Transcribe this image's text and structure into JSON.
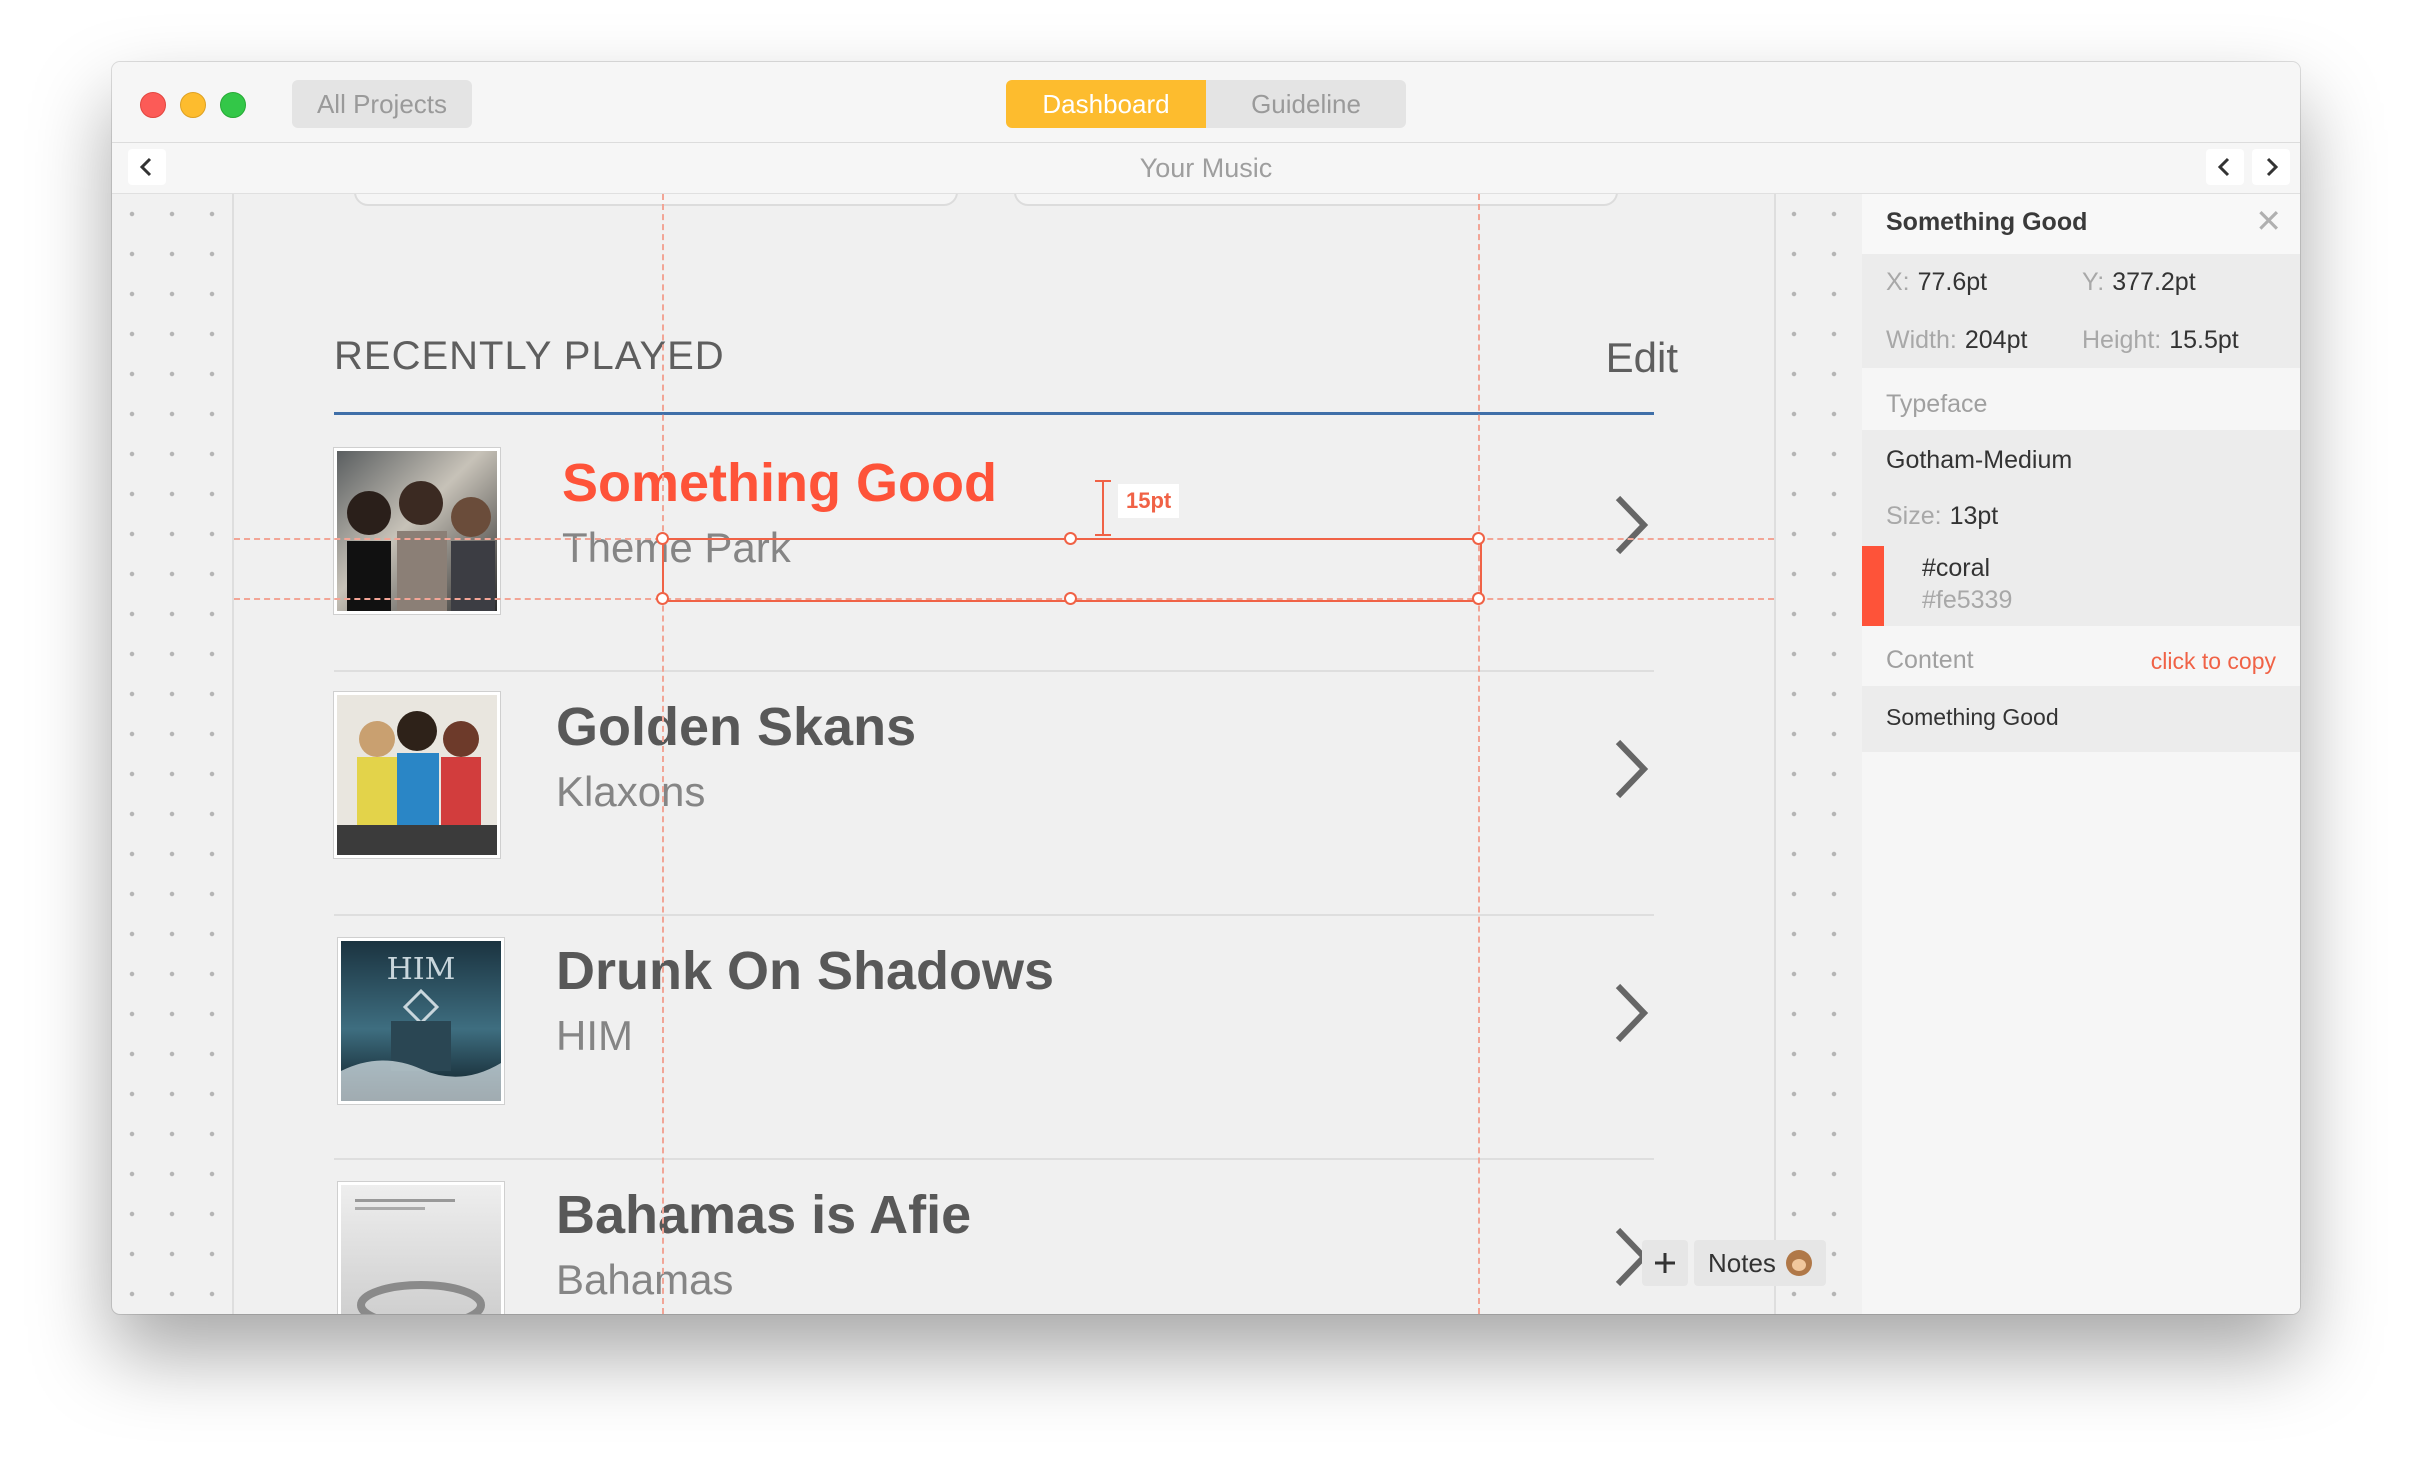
{
  "titlebar": {
    "all_projects": "All Projects",
    "tabs": [
      {
        "label": "Dashboard",
        "active": true
      },
      {
        "label": "Guideline",
        "active": false
      }
    ]
  },
  "navbar": {
    "back_icon": "chevron-left-icon",
    "title": "Your Music",
    "prev_icon": "chevron-left-icon",
    "next_icon": "chevron-right-icon"
  },
  "canvas": {
    "section_title": "RECENTLY PLAYED",
    "edit_label": "Edit",
    "measure_label": "15pt",
    "rows": [
      {
        "title": "Something Good",
        "artist": "Theme Park",
        "selected": true
      },
      {
        "title": "Golden Skans",
        "artist": "Klaxons",
        "selected": false
      },
      {
        "title": "Drunk On Shadows",
        "artist": "HIM",
        "selected": false
      },
      {
        "title": "Bahamas is Afie",
        "artist": "Bahamas",
        "selected": false
      }
    ],
    "cover_text": "HIM",
    "notes": {
      "add_icon": "plus-icon",
      "label": "Notes",
      "emoji_icon": "monkey-icon"
    }
  },
  "inspector": {
    "title": "Something Good",
    "close_icon": "close-icon",
    "x_label": "X:",
    "x_value": "77.6pt",
    "y_label": "Y:",
    "y_value": "377.2pt",
    "width_label": "Width:",
    "width_value": "204pt",
    "height_label": "Height:",
    "height_value": "15.5pt",
    "typeface_label": "Typeface",
    "typeface_value": "Gotham-Medium",
    "size_label": "Size:",
    "size_value": "13pt",
    "color_name": "#coral",
    "color_hex": "#fe5339",
    "content_label": "Content",
    "copy_label": "click to copy",
    "content_value": "Something Good"
  },
  "colors": {
    "accent": "#fdbc2e",
    "highlight": "#f06246",
    "selected_text": "#fe5339",
    "selection_underline": "#3f6fa8"
  }
}
